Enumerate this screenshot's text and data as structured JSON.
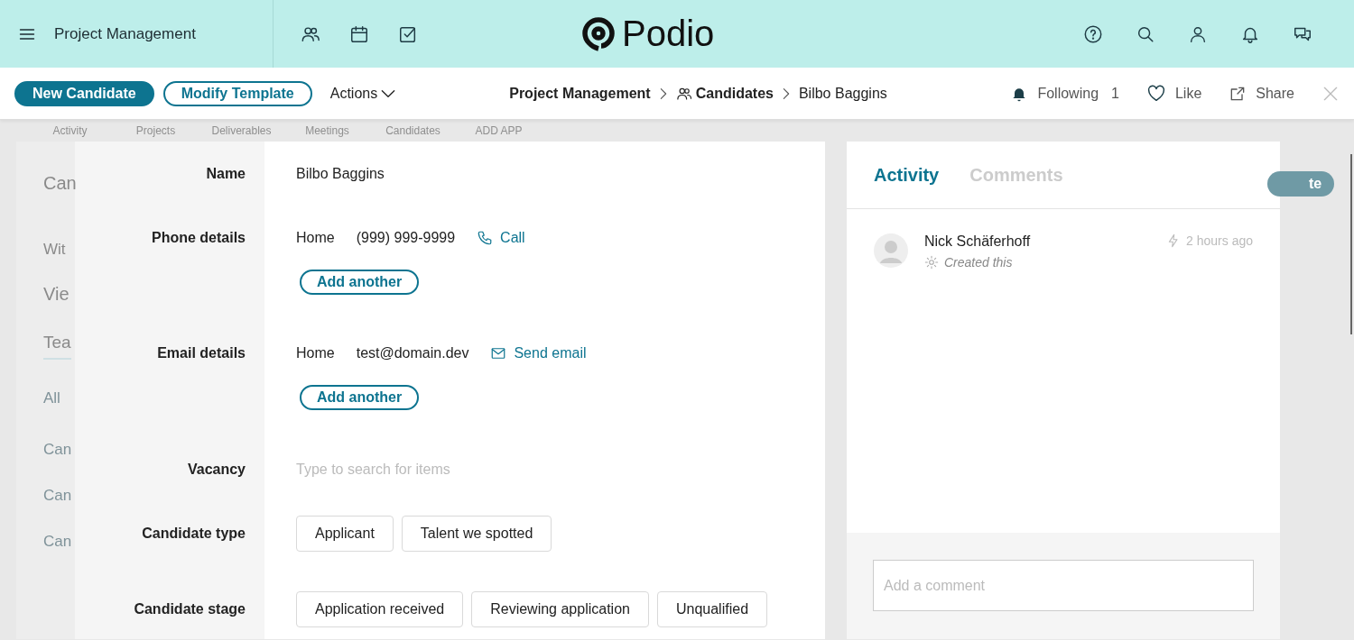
{
  "header": {
    "title": "Project Management",
    "logo": "Podio"
  },
  "toolbar": {
    "primary_button": "New Candidate",
    "secondary_button": "Modify Template",
    "actions": "Actions",
    "breadcrumb": [
      {
        "label": "Project Management",
        "kind": "workspace"
      },
      {
        "label": "Candidates",
        "kind": "app"
      },
      {
        "label": "Bilbo Baggins",
        "kind": "item"
      }
    ],
    "following": "Following",
    "following_count": "1",
    "like": "Like",
    "share": "Share"
  },
  "background": {
    "tabs": [
      "Activity",
      "Projects",
      "Deliverables",
      "Meetings",
      "Candidates",
      "ADD APP"
    ],
    "side_texts": [
      "Can",
      "Wit",
      "Vie",
      "Tea",
      "All",
      "Can",
      "Can",
      "Can"
    ],
    "side_button": "te"
  },
  "form": {
    "fields": [
      {
        "label": "Name",
        "kind": "text",
        "value": "Bilbo Baggins"
      },
      {
        "label": "Phone details",
        "kind": "phone",
        "type": "Home",
        "value": "(999) 999-9999",
        "action": "Call",
        "add": "Add another"
      },
      {
        "label": "Email details",
        "kind": "email",
        "type": "Home",
        "value": "test@domain.dev",
        "action": "Send email",
        "add": "Add another"
      },
      {
        "label": "Vacancy",
        "kind": "search",
        "placeholder": "Type to search for items"
      },
      {
        "label": "Candidate type",
        "kind": "options",
        "options": [
          "Applicant",
          "Talent we spotted"
        ]
      },
      {
        "label": "Candidate stage",
        "kind": "options",
        "options": [
          "Application received",
          "Reviewing application",
          "Unqualified"
        ]
      }
    ]
  },
  "activity": {
    "tabs": [
      {
        "label": "Activity",
        "selected": true
      },
      {
        "label": "Comments",
        "selected": false
      }
    ],
    "entries": [
      {
        "author": "Nick Schäferhoff",
        "action": "Created this",
        "time": "2 hours ago"
      }
    ],
    "comment": {
      "placeholder": "Add a comment"
    }
  }
}
